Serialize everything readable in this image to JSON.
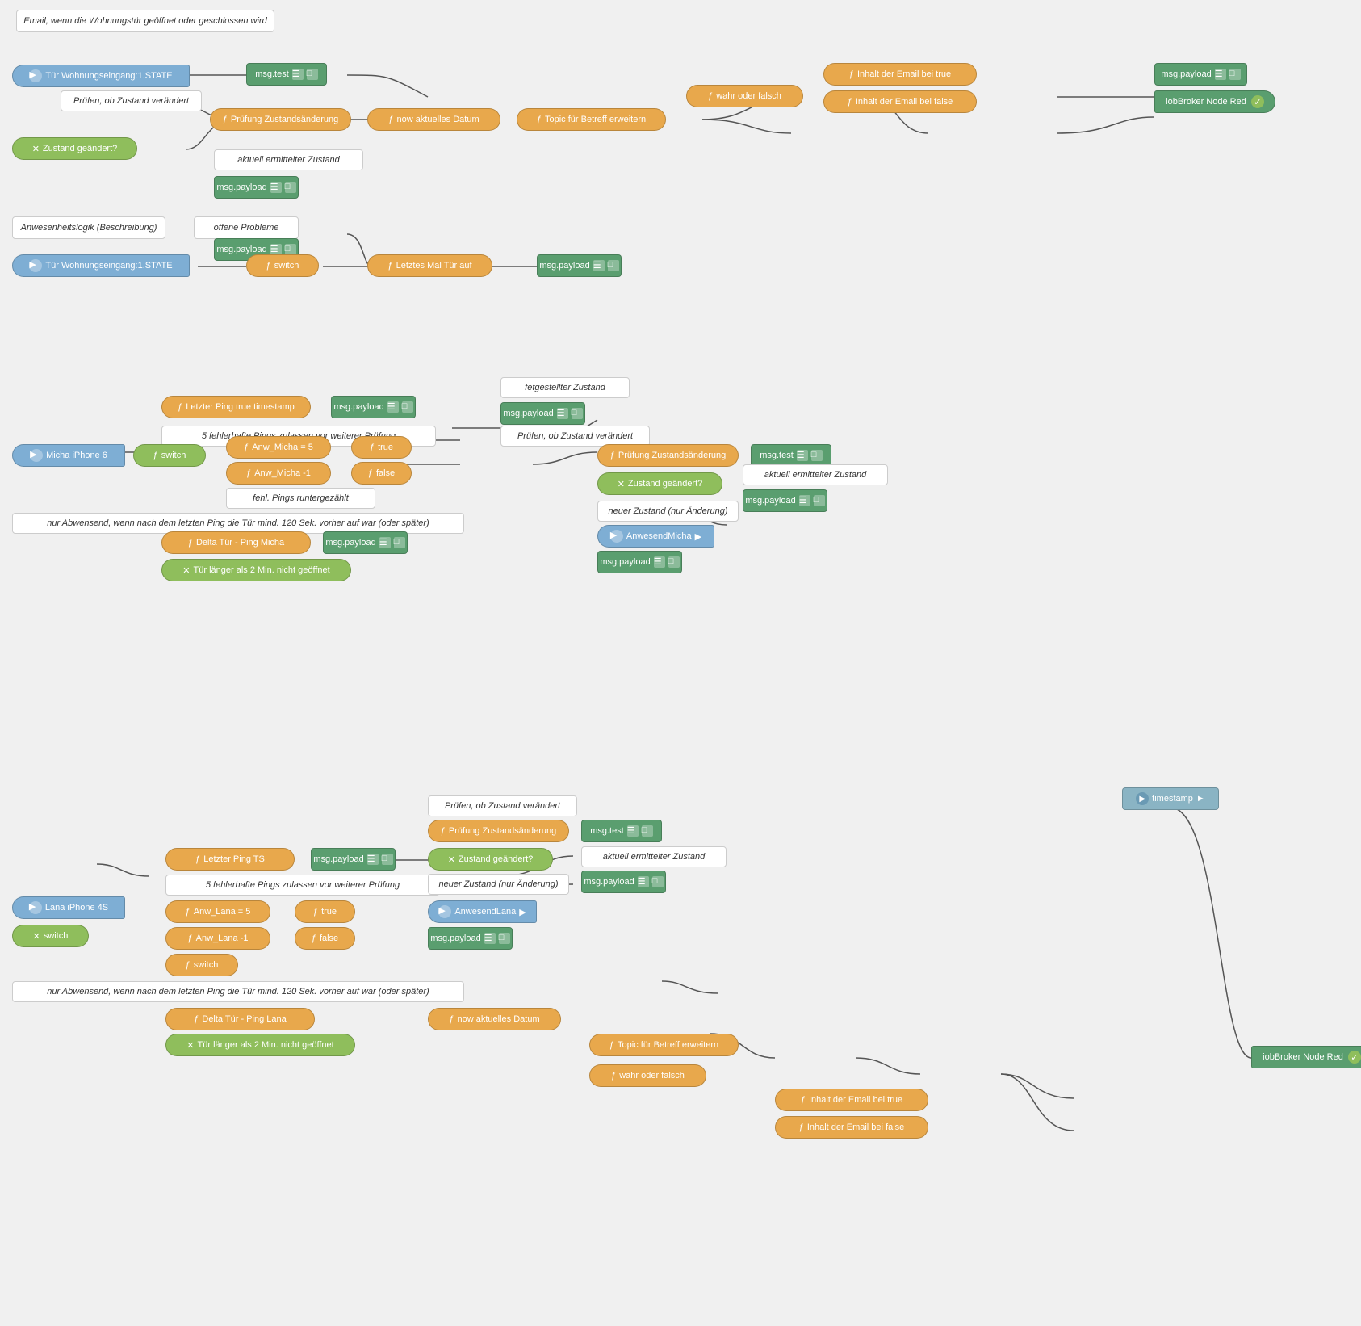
{
  "nodes": {
    "section1": {
      "comment_email": "Email, wenn die Wohnungstür geöffnet oder geschlossen wird",
      "input_tur1": "Tür Wohnungseingang:1.STATE",
      "msg_test1": "msg.test",
      "prufen1": "Prüfen, ob Zustand verändert",
      "prufung1": "Prüfung Zustandsänderung",
      "now1": "now aktuelles Datum",
      "topic1": "Topic für Betreff erweitern",
      "wahr_falsch": "wahr oder falsch",
      "inhalt_true": "Inhalt der Email bei true",
      "inhalt_false": "Inhalt der Email bei false",
      "msg_payload1": "msg.payload",
      "iob_red1": "iobBroker Node Red",
      "zustand1": "Zustand geändert?",
      "aktuell1": "aktuell ermittelter Zustand",
      "msg_payload2": "msg.payload",
      "anwesenheit": "Anwesenheitslogik (Beschreibung)",
      "offene": "offene Probleme",
      "input_tur2": "Tür Wohnungseingang:1.STATE",
      "msg_payload3": "msg.payload",
      "switch1": "switch",
      "letztes_mal": "Letztes Mal Tür auf",
      "msg_payload4": "msg.payload"
    },
    "section2": {
      "letzter_ping_true": "Letzter Ping true timestamp",
      "msg_payload_s2_1": "msg.payload",
      "fetgestellt": "fetgestellter Zustand",
      "msg_payload_s2_2": "msg.payload",
      "fehlerhafte": "5 fehlerhafte Pings zulassen vor weiterer Prüfung",
      "prufen_s2": "Prüfen, ob Zustand verändert",
      "micha_iphone": "Micha iPhone 6",
      "switch_s2": "switch",
      "anw_micha5": "Anw_Micha = 5",
      "anw_micha_m1": "Anw_Micha -1",
      "fehl_pings": "fehl. Pings runtergezählt",
      "true_node": "true",
      "false_node": "false",
      "prufung_s2": "Prüfung Zustandsänderung",
      "msg_test_s2": "msg.test",
      "zustand_s2": "Zustand geändert?",
      "aktuell_s2": "aktuell ermittelter Zustand",
      "msg_payload_s2_3": "msg.payload",
      "abwesend_note": "nur Abwensend, wenn nach dem letzten Ping die Tür mind. 120 Sek. vorher auf war (oder später)",
      "neuer_zustand_s2": "neuer Zustand (nur Änderung)",
      "delta_tur_micha": "Delta Tür - Ping Micha",
      "msg_payload_s2_4": "msg.payload",
      "tur_langer": "Tür länger als 2 Min. nicht geöffnet",
      "anwesend_micha": "AnwesendMicha",
      "msg_payload_s2_5": "msg.payload"
    },
    "section3": {
      "timestamp_s3": "timestamp",
      "prufen_s3": "Prüfen, ob Zustand verändert",
      "letzter_ping_ts": "Letzter Ping TS",
      "msg_payload_s3_1": "msg.payload",
      "fehlerhafte_s3": "5 fehlerhafte Pings zulassen vor weiterer Prüfung",
      "lana_iphone": "Lana iPhone 4S",
      "switch_s3_outer": "switch",
      "anw_lana5": "Anw_Lana = 5",
      "anw_lana_m1": "Anw_Lana -1",
      "switch_s3_inner": "switch",
      "true_s3": "true",
      "false_s3": "false",
      "prufung_s3": "Prüfung Zustandsänderung",
      "msg_test_s3": "msg.test",
      "zustand_s3": "Zustand geändert?",
      "aktuell_s3": "aktuell ermittelter Zustand",
      "msg_payload_s3_2": "msg.payload",
      "abwesend_s3": "nur Abwensend, wenn nach dem letzten Ping die Tür mind. 120 Sek. vorher auf war (oder später)",
      "neuer_zustand_s3": "neuer Zustand (nur Änderung)",
      "delta_tur_lana": "Delta Tür - Ping Lana",
      "tur_langer_s3": "Tür länger als 2 Min. nicht geöffnet",
      "anwesend_lana": "AnwesendLana",
      "msg_payload_s3_3": "msg.payload",
      "now_s3": "now aktuelles Datum",
      "topic_s3": "Topic für Betreff erweitern",
      "wahr_falsch_s3": "wahr oder falsch",
      "inhalt_true_s3": "Inhalt der Email bei true",
      "inhalt_false_s3": "Inhalt der Email bei false",
      "iob_red_s3": "iobBroker Node Red"
    }
  },
  "colors": {
    "orange": "#e8a84c",
    "green": "#5a9e6f",
    "yellow_green": "#8fbe5c",
    "blue_input": "#7eaed4",
    "white_bg": "#ffffff",
    "teal": "#6aada8",
    "gray": "#999999",
    "blue_output": "#7eb8c4",
    "iob_green": "#5a9e6f",
    "canvas_bg": "#f0f0f0"
  }
}
